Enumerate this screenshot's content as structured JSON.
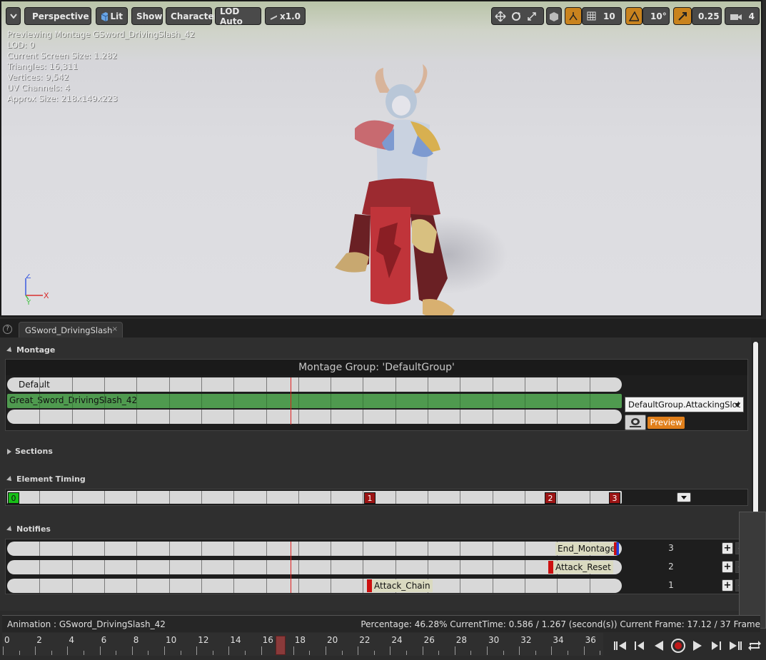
{
  "viewport": {
    "toolbar": {
      "perspective": "Perspective",
      "lit": "Lit",
      "show": "Show",
      "character": "Character",
      "lod": "LOD Auto",
      "speed": "x1.0",
      "grid_snap": "10",
      "rotation_snap": "10°",
      "scale_snap": "0.25",
      "camera_speed": "4"
    },
    "stats": [
      "Previewing Montage GSword_DrivingSlash_42",
      "LOD: 0",
      "Current Screen Size: 1.282",
      "Triangles: 16,311",
      "Vertices: 9,542",
      "UV Channels: 4",
      "Approx Size: 218x149x223"
    ],
    "axis": {
      "x": "X",
      "y": "Y",
      "z": "Z"
    }
  },
  "tab": {
    "label": "GSword_DrivingSlash",
    "close": "×",
    "help": "?"
  },
  "montage": {
    "header": "Montage",
    "group_title": "Montage Group: 'DefaultGroup'",
    "section_label": "Default",
    "segment_label": "Great_Sword_DrivingSlash_42",
    "slot": "DefaultGroup.AttackingSlot",
    "preview": "Preview"
  },
  "sections": {
    "header": "Sections"
  },
  "element_timing": {
    "header": "Element Timing",
    "markers": [
      "0",
      "1",
      "2",
      "3"
    ]
  },
  "notifies": {
    "header": "Notifies",
    "tracks": [
      {
        "number": "3",
        "label": "End_Montage"
      },
      {
        "number": "2",
        "label": "Attack_Reset"
      },
      {
        "number": "1",
        "label": "Attack_Chain"
      }
    ],
    "plus": "+",
    "minus": "-"
  },
  "status": {
    "animation": "Animation :  GSword_DrivingSlash_42",
    "info": "Percentage:  46.28% CurrentTime:  0.586 / 1.267 (second(s)) Current Frame:  17.12 / 37 Frame"
  },
  "timeline": {
    "ticks": [
      "0",
      "2",
      "4",
      "6",
      "8",
      "10",
      "12",
      "14",
      "16",
      "18",
      "20",
      "22",
      "24",
      "26",
      "28",
      "30",
      "32",
      "34",
      "36"
    ],
    "current_frame": 17.12,
    "total_frames": 37
  },
  "colors": {
    "accent_orange": "#e07f1b",
    "segment_green": "#4f9a4f",
    "marker_red": "#9c1414",
    "marker_green": "#18c018"
  }
}
